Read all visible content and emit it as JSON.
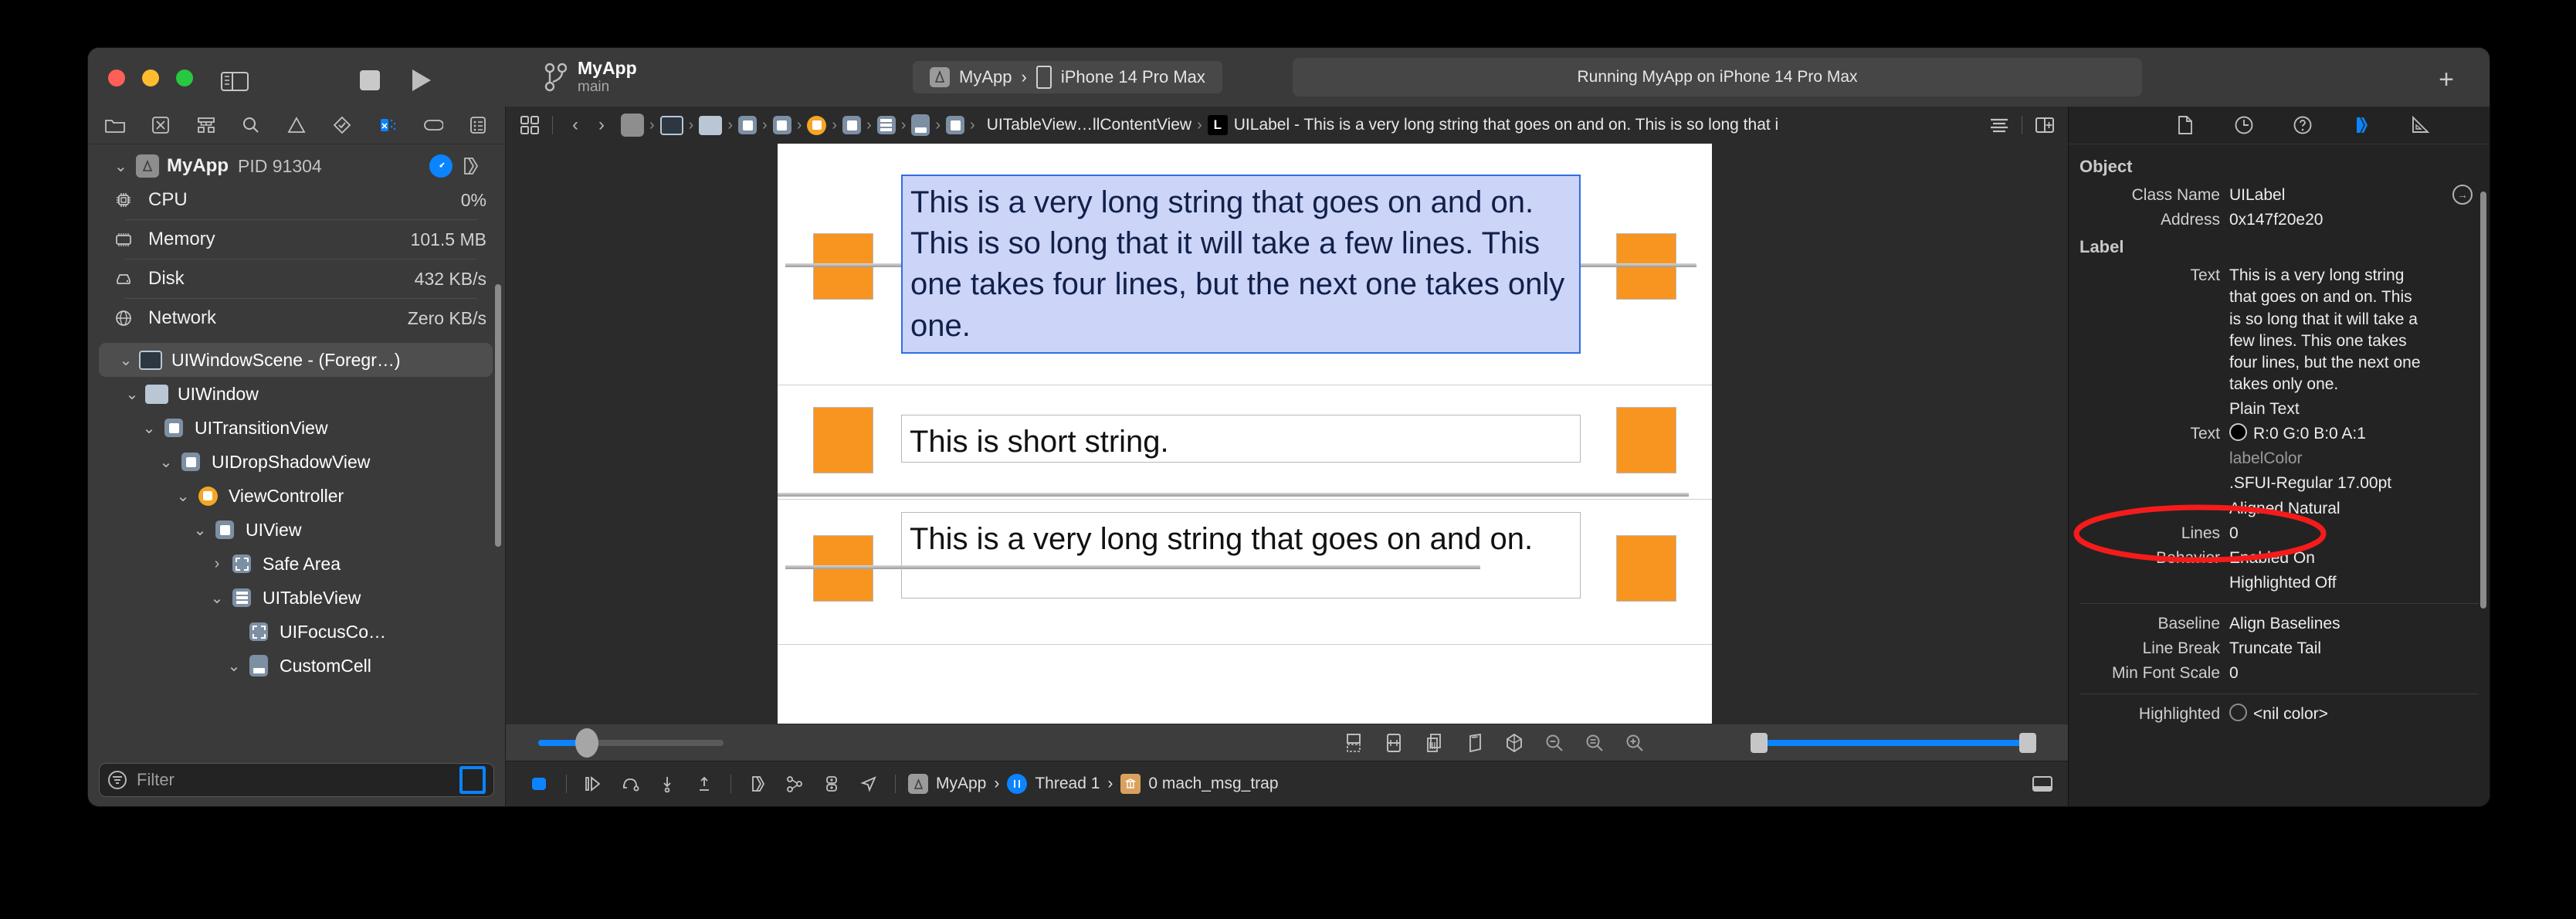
{
  "titlebar": {
    "scheme_name": "MyApp",
    "branch": "main",
    "destination_app": "MyApp",
    "destination_device": "iPhone 14 Pro Max",
    "status": "Running MyApp on iPhone 14 Pro Max",
    "chevron": "›",
    "plus": "+"
  },
  "sidebar": {
    "toolbar_icons": [
      "folder-icon",
      "source-control-icon",
      "hierarchy-icon",
      "search-icon",
      "warning-icon",
      "test-icon",
      "debug-icon",
      "breakpoint-icon",
      "report-icon"
    ],
    "gauges": [
      {
        "label": "MyApp",
        "pid": "PID 91304",
        "value": "",
        "icon": "app-icon",
        "header": true
      },
      {
        "label": "CPU",
        "value": "0%",
        "icon": "cpu-icon"
      },
      {
        "label": "Memory",
        "value": "101.5 MB",
        "icon": "memory-icon"
      },
      {
        "label": "Disk",
        "value": "432 KB/s",
        "icon": "disk-icon"
      },
      {
        "label": "Network",
        "value": "Zero KB/s",
        "icon": "network-icon"
      }
    ],
    "tree": [
      {
        "label": "UIWindowScene - (Foregr…)",
        "indent": 0,
        "twisty": "⌄",
        "icon": "scene-icon",
        "selected": true
      },
      {
        "label": "UIWindow",
        "indent": 1,
        "twisty": "⌄",
        "icon": "window-icon"
      },
      {
        "label": "UITransitionView",
        "indent": 2,
        "twisty": "⌄",
        "icon": "view-icon"
      },
      {
        "label": "UIDropShadowView",
        "indent": 3,
        "twisty": "⌄",
        "icon": "view-icon"
      },
      {
        "label": "ViewController",
        "indent": 4,
        "twisty": "⌄",
        "icon": "viewcontroller-icon"
      },
      {
        "label": "UIView",
        "indent": 5,
        "twisty": "⌄",
        "icon": "view-icon"
      },
      {
        "label": "Safe Area",
        "indent": 6,
        "twisty": "›",
        "icon": "safearea-icon"
      },
      {
        "label": "UITableView",
        "indent": 6,
        "twisty": "⌄",
        "icon": "tableview-icon"
      },
      {
        "label": "UIFocusCo…",
        "indent": 7,
        "twisty": "",
        "icon": "safearea-icon"
      },
      {
        "label": "CustomCell",
        "indent": 7,
        "twisty": "⌄",
        "icon": "cell-icon"
      }
    ],
    "filter_placeholder": "Filter"
  },
  "jumpbar": {
    "crumb_icons": [
      "app-icon",
      "scene-icon",
      "window-icon",
      "view-icon",
      "view-icon",
      "viewcontroller-icon",
      "view-icon",
      "tableview-icon",
      "cell-icon",
      "view-icon"
    ],
    "path_prefix": "UITableView…llContentView",
    "badge": "L",
    "title": "UILabel - This is a very long string that goes on and on. This is so long that i",
    "back": "‹",
    "forward": "›",
    "separator": "›"
  },
  "canvas": {
    "cells": [
      {
        "text": "This is a very long string that goes on and on. This is so long that it will take a few lines. This one takes four lines, but the next one takes only one.",
        "selected": true
      },
      {
        "text": "This is short string.",
        "selected": false
      },
      {
        "text": "This is a very long string that goes on and on.",
        "selected": false
      }
    ],
    "accent_orange": "#f79520",
    "selection_blue": "#2f6fe0",
    "selection_fill": "#ccd4f7"
  },
  "canvasbar": {
    "zoom_icons": [
      "unclip-icon",
      "spacing-icon",
      "layers-icon",
      "perspective-icon",
      "wireframe-icon",
      "zoom-out-icon",
      "zoom-reset-icon",
      "zoom-in-icon"
    ],
    "left_slider_percent": 25,
    "right_range_min": 0,
    "right_range_max": 100
  },
  "debugbar": {
    "icons": [
      "console-toggle-icon",
      "continue-icon",
      "step-over-icon",
      "step-into-icon",
      "step-out-icon",
      "view-debug-icon",
      "memory-graph-icon",
      "simulate-icon",
      "location-icon"
    ],
    "process": "MyApp",
    "thread": "Thread 1",
    "frame": "0 mach_msg_trap",
    "separator": "›"
  },
  "inspector": {
    "tabs": [
      "file-inspector-icon",
      "history-inspector-icon",
      "quick-help-icon",
      "object-inspector-icon",
      "size-inspector-icon"
    ],
    "active_tab_index": 3,
    "sections": [
      {
        "title": "Object",
        "rows": [
          {
            "key": "Class Name",
            "value": "UILabel",
            "arrow": true
          },
          {
            "key": "Address",
            "value": "0x147f20e20"
          }
        ]
      },
      {
        "title": "Label",
        "rows": [
          {
            "key": "Text",
            "value": "This is a very long string that goes on and on. This is so long that it will take a few lines. This one takes four lines, but the next one takes only one.",
            "wrap": true
          },
          {
            "key": "",
            "value": "Plain Text"
          },
          {
            "key": "Text",
            "value": "R:0 G:0 B:0 A:1",
            "swatch": "#000000"
          },
          {
            "key": "",
            "value": "labelColor",
            "sub": true
          },
          {
            "key": "",
            "value": ".SFUI-Regular 17.00pt"
          },
          {
            "key": "",
            "value": "Aligned Natural"
          },
          {
            "key": "Lines",
            "value": "0",
            "circled": true
          },
          {
            "key": "Behavior",
            "value": "Enabled On"
          },
          {
            "key": "",
            "value": "Highlighted Off"
          }
        ]
      },
      {
        "title": "",
        "rows": [
          {
            "key": "Baseline",
            "value": "Align Baselines"
          },
          {
            "key": "Line Break",
            "value": "Truncate Tail"
          },
          {
            "key": "Min Font Scale",
            "value": "0"
          }
        ]
      },
      {
        "title": "",
        "rows": [
          {
            "key": "Highlighted",
            "value": "<nil color>",
            "swatch": "nil"
          }
        ]
      }
    ],
    "annotation_color": "#f51b1b"
  }
}
